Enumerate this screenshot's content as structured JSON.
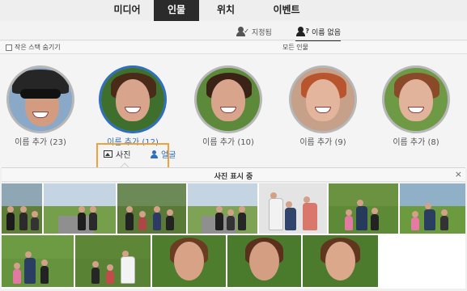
{
  "tabs": [
    {
      "label": "미디어",
      "active": false
    },
    {
      "label": "인물",
      "active": true
    },
    {
      "label": "위치",
      "active": false
    },
    {
      "label": "이벤트",
      "active": false
    }
  ],
  "filters": {
    "named": "지정됨",
    "unnamed": "이름 없음"
  },
  "options": {
    "hide_small_stacks": "작은 스택 숨기기",
    "all_people": "모든 인물"
  },
  "faces": [
    {
      "label": "이름 추가 (23)",
      "selected": false
    },
    {
      "label": "이름 추가 (12)",
      "selected": true
    },
    {
      "label": "이름 추가 (10)",
      "selected": false
    },
    {
      "label": "이름 추가 (9)",
      "selected": false
    },
    {
      "label": "이름 추가 (8)",
      "selected": false
    }
  ],
  "toggle": {
    "photos": "사진",
    "faces": "얼굴"
  },
  "photos_panel": {
    "title": "사진 표시 중",
    "close": "×"
  },
  "colors": {
    "accent_blue": "#2f6fbf",
    "highlight_orange": "#f0a23a",
    "active_tab": "#2b2b2b"
  }
}
